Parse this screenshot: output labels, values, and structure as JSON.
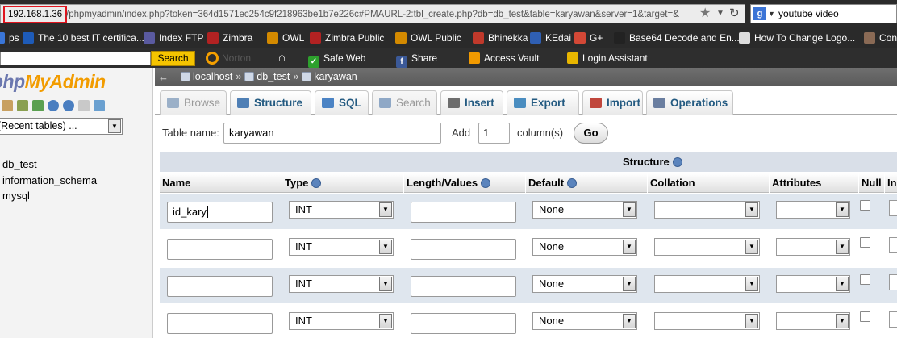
{
  "browser": {
    "url_host": "192.168.1.36",
    "url_rest": "/phpmyadmin/index.php?token=364d1571ec254c9f218963be1b7e226c#PMAURL-2:tbl_create.php?db=db_test&table=karyawan&server=1&target=&",
    "search_engine_icon": "g",
    "search_text": "youtube video"
  },
  "bookmarks": [
    {
      "label": "ps",
      "icon": "apps-icon",
      "color": "#3a76d8"
    },
    {
      "label": "The 10 best IT certifica...",
      "icon": "cert-icon",
      "color": "#1e5bb8"
    },
    {
      "label": "Index FTP",
      "icon": "ftp-icon",
      "color": "#5a5aa0"
    },
    {
      "label": "Zimbra",
      "icon": "zimbra-icon",
      "color": "#b22222"
    },
    {
      "label": "OWL",
      "icon": "owl-icon",
      "color": "#d48a00"
    },
    {
      "label": "Zimbra Public",
      "icon": "zimbra-icon",
      "color": "#b22222"
    },
    {
      "label": "OWL Public",
      "icon": "owl-icon",
      "color": "#d48a00"
    },
    {
      "label": "Bhinekka",
      "icon": "bhinekka-icon",
      "color": "#c0392b"
    },
    {
      "label": "KEdai",
      "icon": "kedai-icon",
      "color": "#2f5fb3"
    },
    {
      "label": "G+",
      "icon": "gplus-icon",
      "color": "#d34836"
    },
    {
      "label": "Base64 Decode and En...",
      "icon": "base64-icon",
      "color": "#222222"
    },
    {
      "label": "How To Change Logo...",
      "icon": "page-icon",
      "color": "#dddddd"
    },
    {
      "label": "Con",
      "icon": "avatar-icon",
      "color": "#8a6a55"
    }
  ],
  "toolbar": {
    "search_button": "Search",
    "norton_label": "Norton",
    "safe_web": "Safe Web",
    "share": "Share",
    "access_vault": "Access Vault",
    "login_assistant": "Login Assistant"
  },
  "left_nav": {
    "logo_php": "php",
    "logo_myadmin": "MyAdmin",
    "recent_tables": "(Recent tables) ...",
    "databases": [
      "db_test",
      "information_schema",
      "mysql"
    ]
  },
  "breadcrumb": {
    "server": "localhost",
    "database": "db_test",
    "table": "karyawan",
    "separator": "»"
  },
  "tabs": [
    {
      "label": "Browse",
      "icon": "browse-icon",
      "disabled": true
    },
    {
      "label": "Structure",
      "icon": "structure-icon",
      "disabled": false
    },
    {
      "label": "SQL",
      "icon": "sql-icon",
      "disabled": false
    },
    {
      "label": "Search",
      "icon": "search-icon",
      "disabled": true
    },
    {
      "label": "Insert",
      "icon": "insert-icon",
      "disabled": false
    },
    {
      "label": "Export",
      "icon": "export-icon",
      "disabled": false
    },
    {
      "label": "Import",
      "icon": "import-icon",
      "disabled": false
    },
    {
      "label": "Operations",
      "icon": "operations-icon",
      "disabled": false
    }
  ],
  "form": {
    "table_name_label": "Table name:",
    "table_name_value": "karyawan",
    "add_label": "Add",
    "add_value": "1",
    "columns_label": "column(s)",
    "go_button": "Go"
  },
  "structure": {
    "title": "Structure",
    "headers": [
      "Name",
      "Type",
      "Length/Values",
      "Default",
      "Collation",
      "Attributes",
      "Null",
      "In"
    ],
    "rows": [
      {
        "name": "id_kary",
        "type": "INT",
        "length": "",
        "default": "None",
        "collation": "",
        "attributes": ""
      },
      {
        "name": "",
        "type": "INT",
        "length": "",
        "default": "None",
        "collation": "",
        "attributes": ""
      },
      {
        "name": "",
        "type": "INT",
        "length": "",
        "default": "None",
        "collation": "",
        "attributes": ""
      },
      {
        "name": "",
        "type": "INT",
        "length": "",
        "default": "None",
        "collation": "",
        "attributes": ""
      }
    ]
  }
}
